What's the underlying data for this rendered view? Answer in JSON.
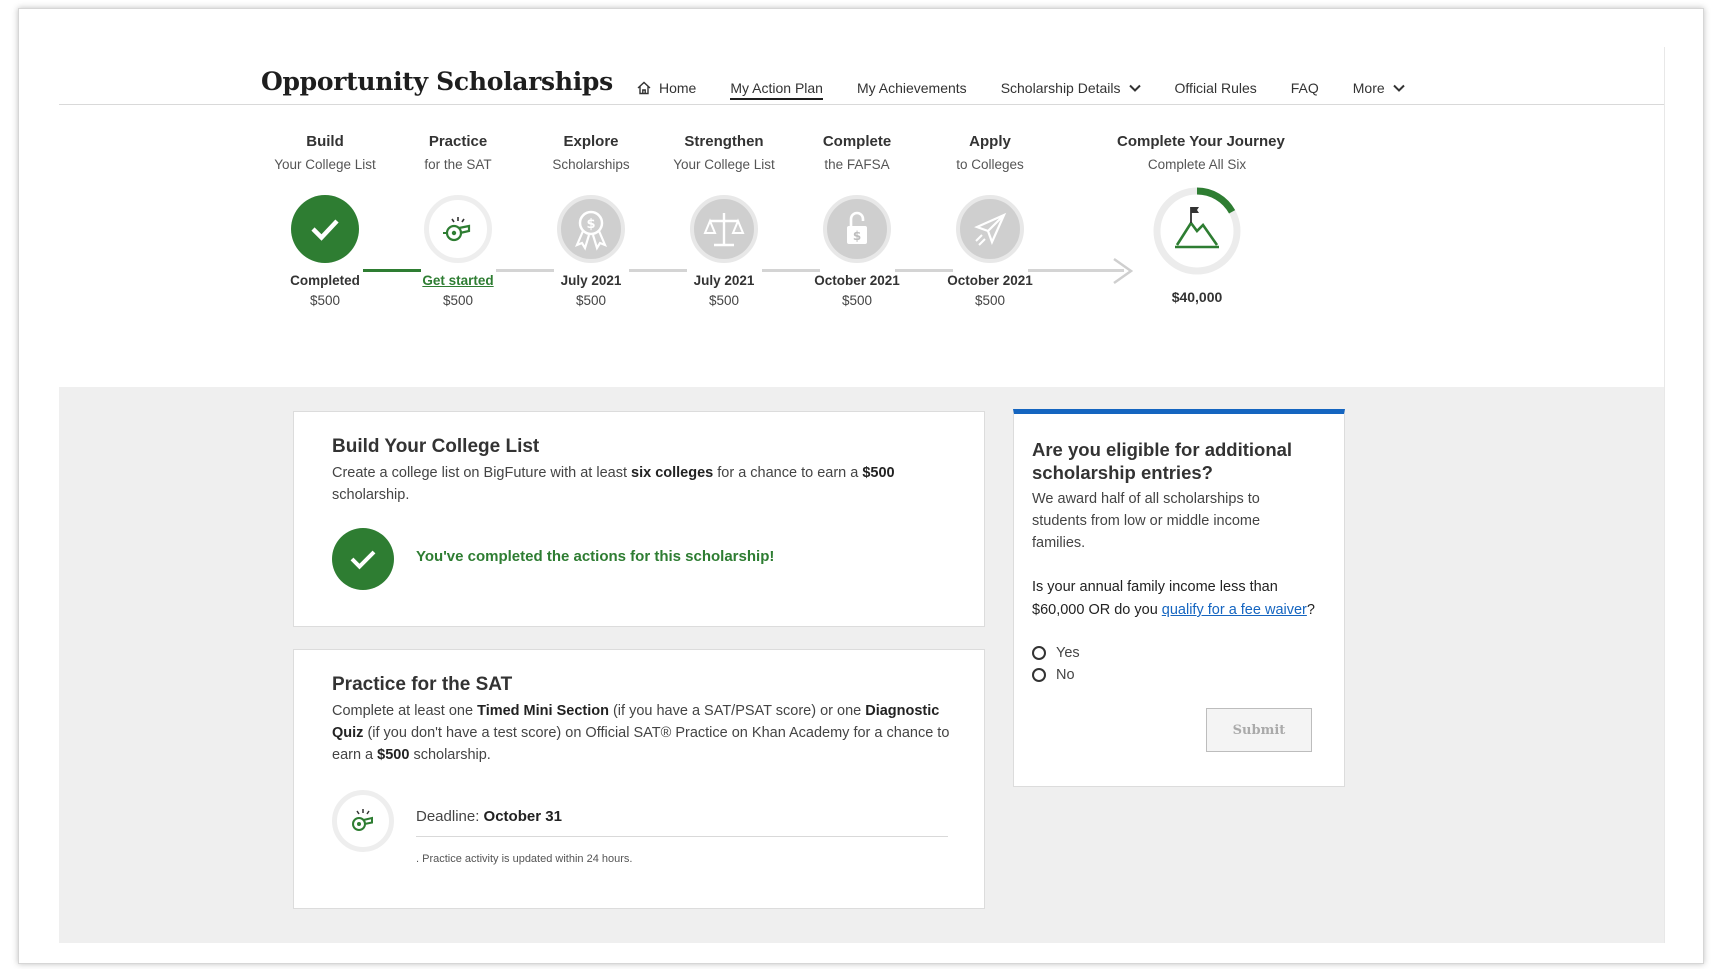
{
  "header": {
    "logo": "Opportunity Scholarships",
    "nav": {
      "home": "Home",
      "action_plan": "My Action Plan",
      "achievements": "My Achievements",
      "scholarship_details": "Scholarship Details",
      "official_rules": "Official Rules",
      "faq": "FAQ",
      "more": "More"
    }
  },
  "steps": [
    {
      "title": "Build",
      "sub": "Your College List",
      "date": "Completed",
      "amount": "$500",
      "status": "completed",
      "icon": "check-icon"
    },
    {
      "title": "Practice",
      "sub": "for the SAT",
      "date": "Get started",
      "amount": "$500",
      "status": "active",
      "icon": "whistle-icon"
    },
    {
      "title": "Explore",
      "sub": "Scholarships",
      "date": "July 2021",
      "amount": "$500",
      "status": "locked",
      "icon": "award-ribbon-icon"
    },
    {
      "title": "Strengthen",
      "sub": "Your College List",
      "date": "July 2021",
      "amount": "$500",
      "status": "locked",
      "icon": "scale-icon"
    },
    {
      "title": "Complete",
      "sub": "the FAFSA",
      "date": "October 2021",
      "amount": "$500",
      "status": "locked",
      "icon": "padlock-dollar-icon"
    },
    {
      "title": "Apply",
      "sub": "to Colleges",
      "date": "October 2021",
      "amount": "$500",
      "status": "locked",
      "icon": "paper-plane-icon"
    }
  ],
  "journey": {
    "title": "Complete Your Journey",
    "sub": "Complete All Six",
    "amount": "$40,000",
    "icon": "mountain-flag-icon",
    "progress_fraction": 0.17
  },
  "build_card": {
    "title": "Build Your College List",
    "text_1": "Create a college list on BigFuture with at least ",
    "bold_1": "six colleges",
    "text_2": " for a chance to earn a ",
    "bold_2": "$500",
    "text_3": " scholarship.",
    "complete_message": "You've completed the actions for this scholarship!"
  },
  "practice_card": {
    "title": "Practice for the SAT",
    "text_1": "Complete at least one ",
    "bold_1": "Timed Mini Section",
    "text_2": " (if you have a SAT/PSAT score) or one ",
    "bold_2": "Diagnostic Quiz",
    "text_3": " (if you don't have a test score) on Official SAT® Practice on Khan Academy for a chance to earn a ",
    "bold_3": "$500",
    "text_4": " scholarship.",
    "deadline_label": "Deadline: ",
    "deadline_value": "October 31",
    "note": ". Practice activity is updated within 24 hours."
  },
  "eligibility": {
    "title": "Are you eligible for additional scholarship entries?",
    "desc": "We award half of all scholarships to students from low or middle income families.",
    "question_1": "Is your annual family income less than $60,000 OR do you ",
    "question_link": "qualify for a fee waiver",
    "question_end": "?",
    "option_yes": "Yes",
    "option_no": "No",
    "submit": "Submit"
  },
  "colors": {
    "green": "#2e7d32",
    "blue": "#1565c0",
    "gray_bg": "#efefef"
  }
}
